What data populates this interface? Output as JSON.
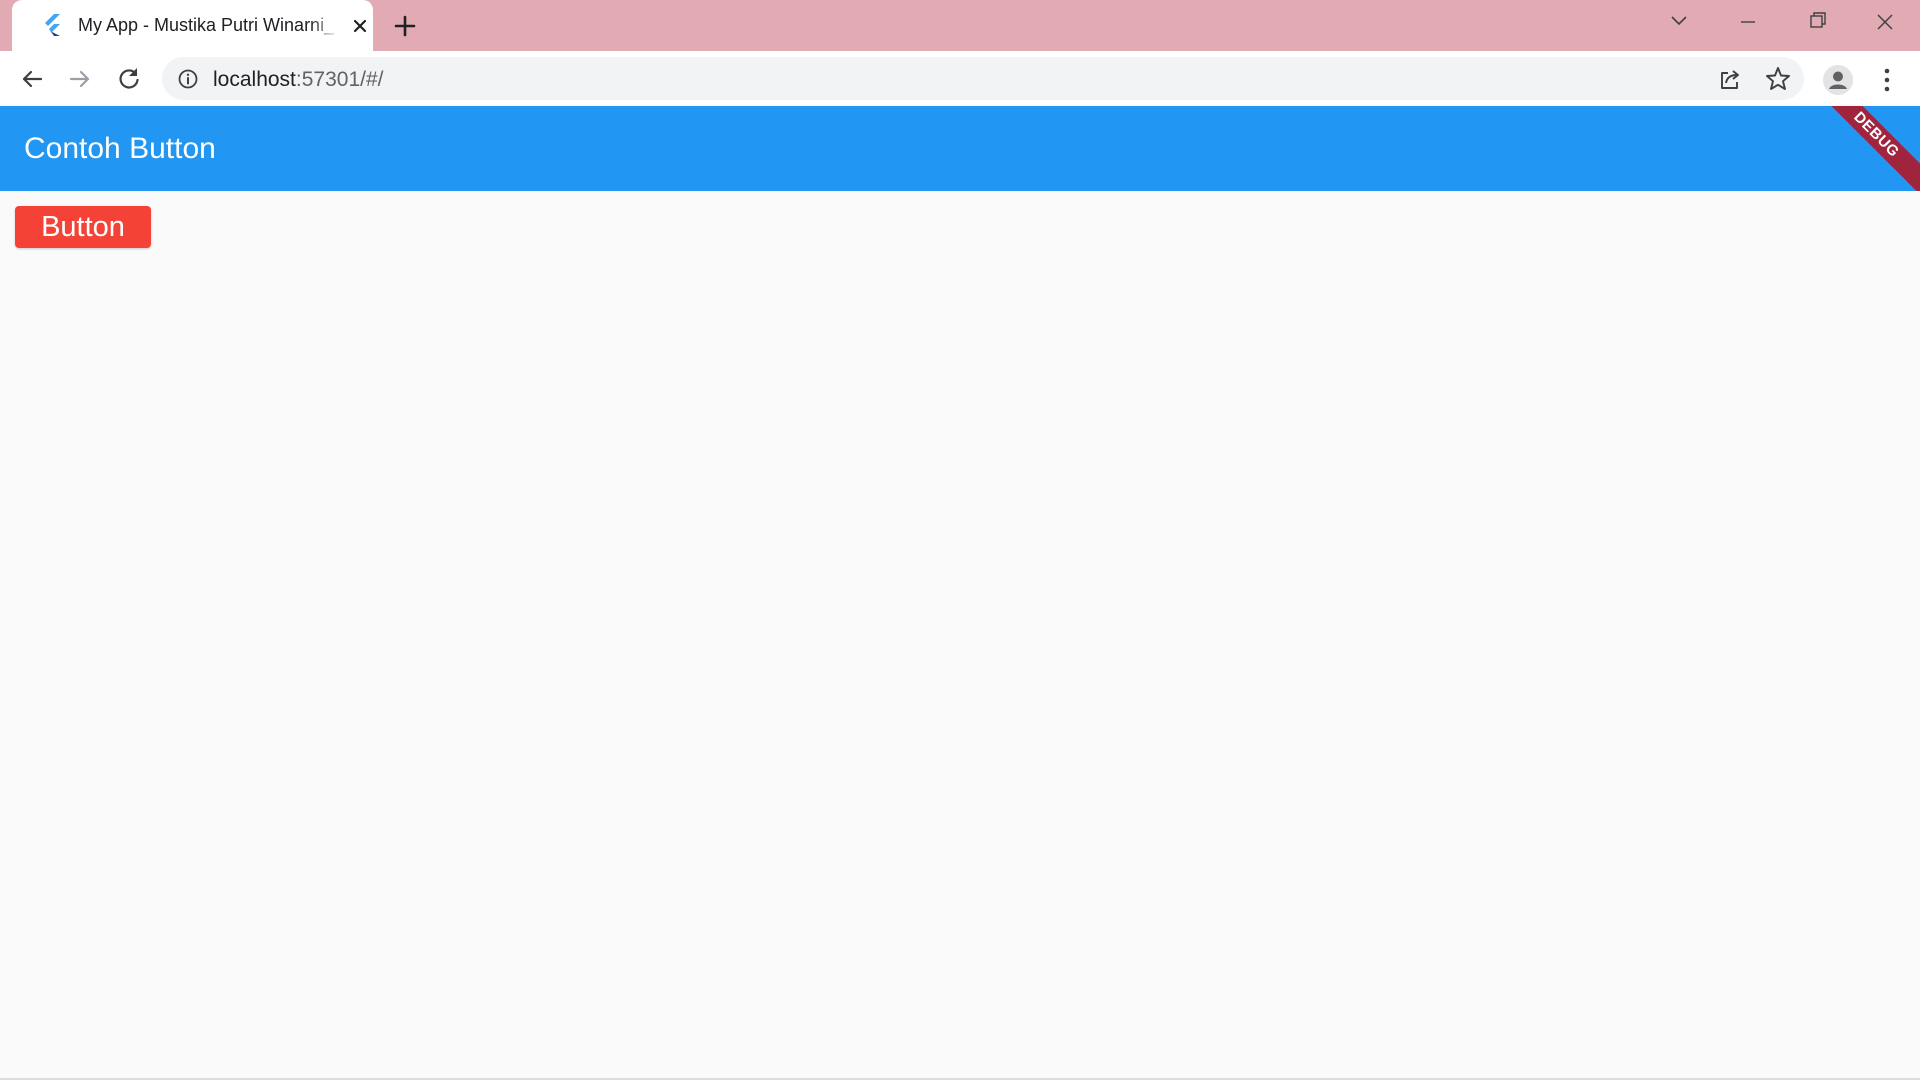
{
  "browser": {
    "tab": {
      "title": "My App - Mustika Putri Winarni_",
      "favicon": "flutter-logo-icon",
      "close_icon": "close-icon"
    },
    "new_tab_icon": "plus-icon",
    "window_controls": [
      "chevron-down-icon",
      "minimize-icon",
      "restore-icon",
      "close-icon"
    ],
    "toolbar": {
      "back_icon": "arrow-left-icon",
      "forward_icon": "arrow-right-icon",
      "reload_icon": "reload-icon",
      "site_info_icon": "info-icon",
      "url_host": "localhost",
      "url_rest": ":57301/#/",
      "share_icon": "share-icon",
      "bookmark_icon": "star-icon",
      "profile_icon": "account-icon",
      "menu_icon": "more-vert-icon"
    },
    "colors": {
      "tabstrip": "#e2aab3",
      "omnibox": "#f1f3f4"
    }
  },
  "app": {
    "appbar": {
      "title": "Contoh Button",
      "color": "#2196f3"
    },
    "debug_banner": "DEBUG",
    "button": {
      "label": "Button",
      "color": "#f44336"
    },
    "background": "#fafafa"
  }
}
